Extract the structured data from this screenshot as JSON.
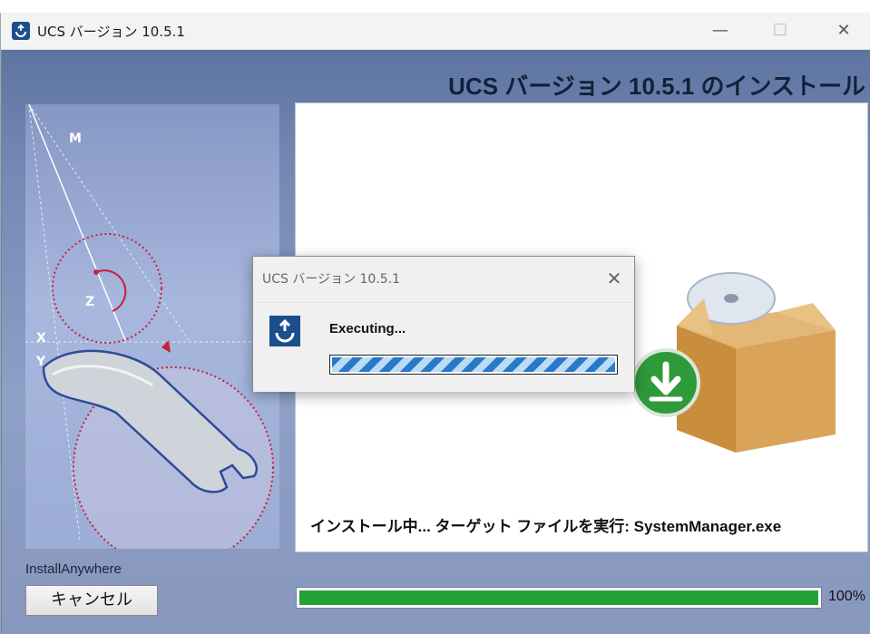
{
  "window": {
    "title": "UCS バージョン 10.5.1",
    "minimize_label": "—",
    "maximize_label": "☐",
    "close_label": "✕"
  },
  "installer": {
    "heading": "UCS バージョン 10.5.1 のインストール",
    "status_text": "インストール中... ターゲット ファイルを実行: SystemManager.exe",
    "brand": "InstallAnywhere",
    "cancel_label": "キャンセル",
    "progress_percent_label": "100%",
    "progress_value": 1.0
  },
  "dialog": {
    "title": "UCS バージョン 10.5.1",
    "close_label": "✕",
    "message": "Executing..."
  },
  "colors": {
    "accent": "#1b4f8c",
    "progress": "#22a33a",
    "background": "#7f90b4"
  },
  "icons": {
    "app": "ucs-app-icon",
    "download": "download-arrow-icon",
    "package": "package-box-icon",
    "wrench": "wrench-icon"
  }
}
